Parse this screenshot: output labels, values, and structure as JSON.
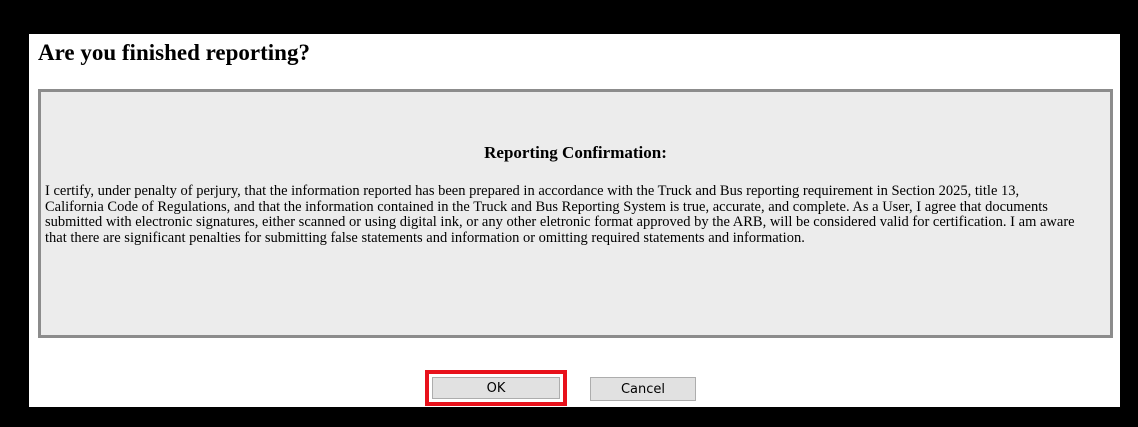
{
  "dialog": {
    "title": "Are you finished reporting?",
    "confirmation": {
      "heading": "Reporting Confirmation:",
      "body": "I certify, under penalty of perjury, that the information reported has been prepared in accordance with the Truck and Bus reporting requirement in Section 2025, title 13, California Code of Regulations, and that the information contained in the Truck and Bus Reporting System is true, accurate, and complete. As a User, I agree that documents submitted with electronic signatures, either scanned or using digital ink, or any other eletronic format approved by the ARB, will be considered valid for certification. I am aware that there are significant penalties for submitting false statements and information or omitting required statements and information."
    },
    "buttons": {
      "ok_label": "OK",
      "cancel_label": "Cancel"
    }
  },
  "colors": {
    "background": "#000000",
    "dialog": "#ffffff",
    "panel": "#ececec",
    "panel_border": "#8c8c8c",
    "highlight": "#e8111b",
    "button": "#e1e1e1"
  }
}
